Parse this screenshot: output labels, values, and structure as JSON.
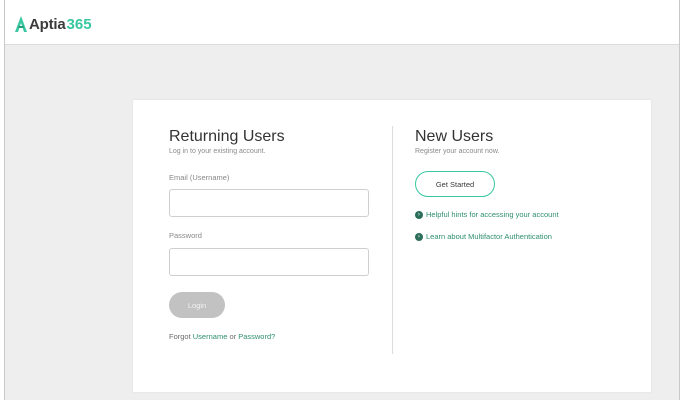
{
  "brand": {
    "name_part1": "Aptia",
    "name_part2": "365"
  },
  "returning": {
    "title": "Returning Users",
    "subtitle": "Log in to your existing account.",
    "email_label": "Email (Username)",
    "password_label": "Password",
    "login_button": "Login",
    "forgot_prefix": "Forgot ",
    "forgot_username": "Username",
    "forgot_or": " or ",
    "forgot_password": "Password?"
  },
  "new_users": {
    "title": "New Users",
    "subtitle": "Register your account now.",
    "get_started_button": "Get Started",
    "links": [
      {
        "label": "Helpful hints for accessing your account",
        "icon": "chevron-right-circle-icon"
      },
      {
        "label": "Learn about Multifactor Authentication",
        "icon": "chevron-right-circle-icon"
      }
    ]
  },
  "colors": {
    "accent": "#38c7a0",
    "link": "#2e8f6e",
    "login_disabled": "#c2c2c2"
  }
}
